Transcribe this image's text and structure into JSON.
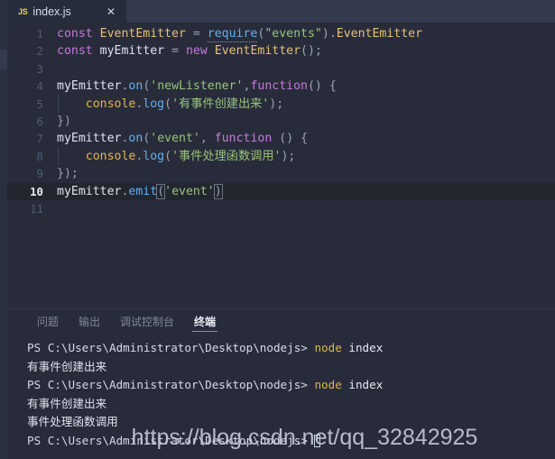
{
  "colors": {
    "editor_bg": "#282c3a",
    "tabbar_bg": "#333a4d",
    "active_tab_bg": "#272c3b",
    "active_line_bg": "#22262f",
    "accent_underline": "#9a7fd0",
    "js_badge": "#e8d44d",
    "keyword": "#c678dd",
    "string": "#98c379",
    "function": "#61afef",
    "type": "#e5c07b",
    "terminal_cmd": "#e0b44c"
  },
  "editor_tabs": [
    {
      "file_icon": "js-file-icon",
      "file_icon_label": "JS",
      "title": "index.js",
      "close_icon": "close-icon",
      "close_glyph": "✕",
      "active": true
    }
  ],
  "editor": {
    "language": "javascript",
    "active_line": 10,
    "total_lines": 11,
    "lines": [
      {
        "num": "1",
        "indent_guide": false,
        "text": "const EventEmitter = require(\"events\").EventEmitter"
      },
      {
        "num": "2",
        "indent_guide": false,
        "text": "const myEmitter = new EventEmitter();"
      },
      {
        "num": "3",
        "indent_guide": false,
        "text": ""
      },
      {
        "num": "4",
        "indent_guide": false,
        "text": "myEmitter.on('newListener',function() {"
      },
      {
        "num": "5",
        "indent_guide": true,
        "text": "    console.log('有事件创建出来');"
      },
      {
        "num": "6",
        "indent_guide": false,
        "text": "})"
      },
      {
        "num": "7",
        "indent_guide": false,
        "text": "myEmitter.on('event', function () {"
      },
      {
        "num": "8",
        "indent_guide": true,
        "text": "    console.log('事件处理函数调用');"
      },
      {
        "num": "9",
        "indent_guide": false,
        "text": "});"
      },
      {
        "num": "10",
        "indent_guide": false,
        "text": "myEmitter.emit('event')"
      },
      {
        "num": "11",
        "indent_guide": false,
        "text": ""
      }
    ]
  },
  "panel": {
    "tabs": [
      {
        "label": "问题",
        "active": false
      },
      {
        "label": "输出",
        "active": false
      },
      {
        "label": "调试控制台",
        "active": false
      },
      {
        "label": "终端",
        "active": true
      }
    ],
    "terminal": {
      "prompt": "PS C:\\Users\\Administrator\\Desktop\\nodejs> ",
      "lines": [
        {
          "type": "command",
          "prompt": "PS C:\\Users\\Administrator\\Desktop\\nodejs> ",
          "cmd": "node",
          "args": " index"
        },
        {
          "type": "output",
          "text": "有事件创建出来"
        },
        {
          "type": "command",
          "prompt": "PS C:\\Users\\Administrator\\Desktop\\nodejs> ",
          "cmd": "node",
          "args": " index"
        },
        {
          "type": "output",
          "text": "有事件创建出来"
        },
        {
          "type": "output",
          "text": "事件处理函数调用"
        },
        {
          "type": "prompt",
          "prompt": "PS C:\\Users\\Administrator\\Desktop\\nodejs> ",
          "cursor": true
        }
      ]
    }
  },
  "watermark": {
    "text": "https://blog.csdn.net/qq_32842925"
  }
}
